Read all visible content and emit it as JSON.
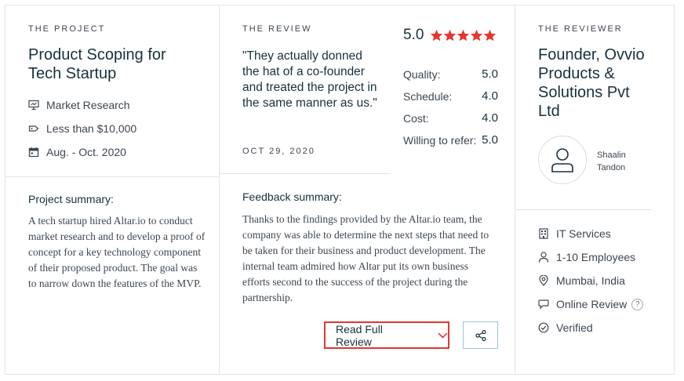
{
  "project": {
    "eyebrow": "THE PROJECT",
    "title": "Product Scoping for Tech Startup",
    "meta": [
      {
        "icon": "presentation-icon",
        "label": "Market Research"
      },
      {
        "icon": "price-tag-icon",
        "label": "Less than $10,000"
      },
      {
        "icon": "calendar-icon",
        "label": "Aug. - Oct. 2020"
      }
    ],
    "summary_heading": "Project summary:",
    "summary": "A tech startup hired Altar.io to conduct market research and to develop a proof of concept for a key technology component of their proposed product. The goal was to narrow down the features of the MVP."
  },
  "review": {
    "eyebrow": "THE REVIEW",
    "quote": "\"They actually donned the hat of a co-founder and treated the project in the same manner as us.\"",
    "date": "OCT 29, 2020",
    "overall": "5.0",
    "stars": 5,
    "star_color": "#e2362f",
    "scores": [
      {
        "label": "Quality:",
        "value": "5.0"
      },
      {
        "label": "Schedule:",
        "value": "4.0"
      },
      {
        "label": "Cost:",
        "value": "4.0"
      },
      {
        "label": "Willing to refer:",
        "value": "5.0"
      }
    ],
    "feedback_heading": "Feedback summary:",
    "feedback": "Thanks to the findings provided by the Altar.io team, the company was able to determine the next steps that need to be taken for their business and product development. The internal team admired how Altar put its own business efforts second to the success of the project during the partnership.",
    "read_more_label": "Read Full Review",
    "accent_color": "#e2362f"
  },
  "reviewer": {
    "eyebrow": "THE REVIEWER",
    "title": "Founder, Ovvio Products & Solutions Pvt Ltd",
    "name_first": "Shaalin",
    "name_last": "Tandon",
    "details": [
      {
        "icon": "building-icon",
        "label": "IT Services"
      },
      {
        "icon": "person-icon",
        "label": "1-10 Employees"
      },
      {
        "icon": "location-pin-icon",
        "label": "Mumbai, India"
      },
      {
        "icon": "chat-bubble-icon",
        "label": "Online Review",
        "help": "?"
      },
      {
        "icon": "check-circle-icon",
        "label": "Verified"
      }
    ]
  }
}
